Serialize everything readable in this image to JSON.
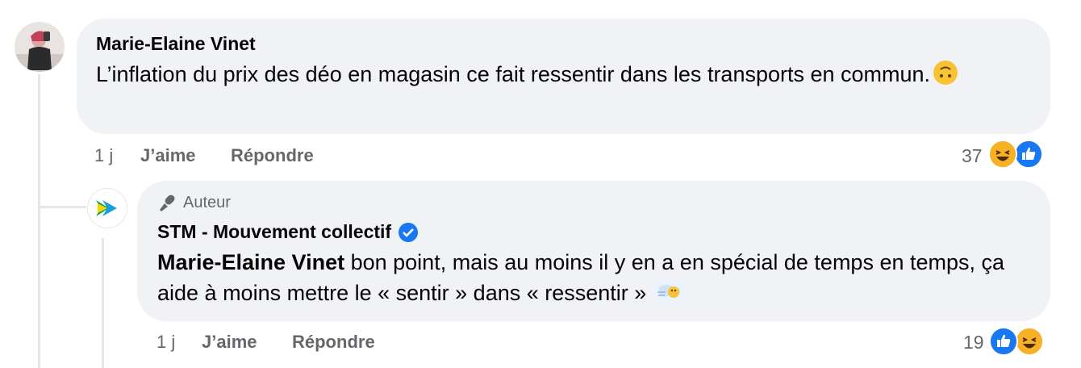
{
  "comment": {
    "author": "Marie-Elaine Vinet",
    "text": "L’inflation du prix des déo en magasin ce fait ressentir dans les transports en commun.",
    "emoji": "upside-down-face",
    "time": "1 j",
    "like_label": "J’aime",
    "reply_label": "Répondre",
    "reaction_count": "37",
    "reactions": [
      "haha",
      "like"
    ]
  },
  "reply": {
    "badge_icon": "microphone-icon",
    "badge_label": "Auteur",
    "author": "STM - Mouvement collectif",
    "verified": true,
    "mention": "Marie-Elaine Vinet",
    "text": " bon point, mais au moins il y en a en spécial de temps en temps, ça aide à moins mettre le « sentir » dans « ressentir »",
    "emoji": "face-with-wind",
    "time": "1 j",
    "like_label": "J’aime",
    "reply_label": "Répondre",
    "reaction_count": "19",
    "reactions": [
      "like",
      "haha"
    ]
  },
  "colors": {
    "bubble": "#f0f2f5",
    "meta_text": "#65676b",
    "like_blue": "#1877f2",
    "haha_yellow": "#f7b125",
    "verified_blue": "#1877f2"
  }
}
